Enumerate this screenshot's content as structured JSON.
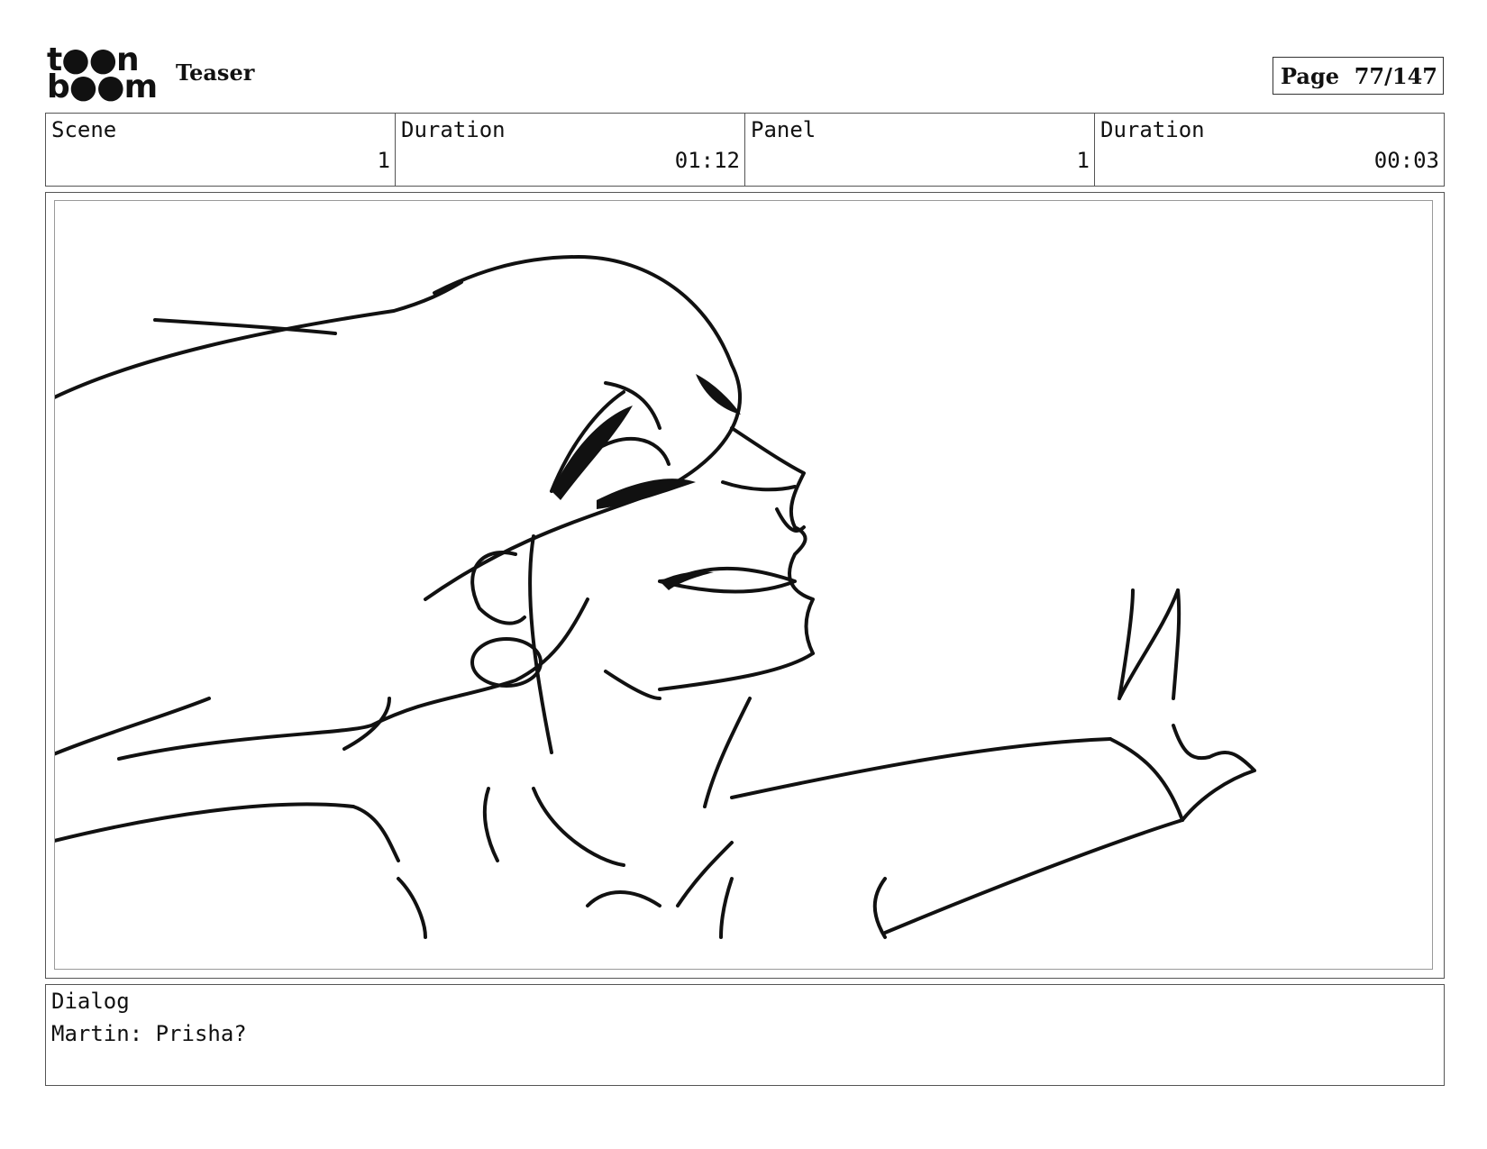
{
  "header": {
    "logo_line1": "t●●n",
    "logo_line2": "b●●m",
    "project_title": "Teaser",
    "page_label": "Page",
    "page_value": "77/147"
  },
  "info": {
    "scene_label": "Scene",
    "scene_value": "1",
    "scene_duration_label": "Duration",
    "scene_duration_value": "01:12",
    "panel_label": "Panel",
    "panel_value": "1",
    "panel_duration_label": "Duration",
    "panel_duration_value": "00:03"
  },
  "dialog": {
    "label": "Dialog",
    "text": "Martin: Prisha?"
  },
  "colors": {
    "ink": "#111111",
    "border": "#555555",
    "inner_border": "#999999"
  }
}
